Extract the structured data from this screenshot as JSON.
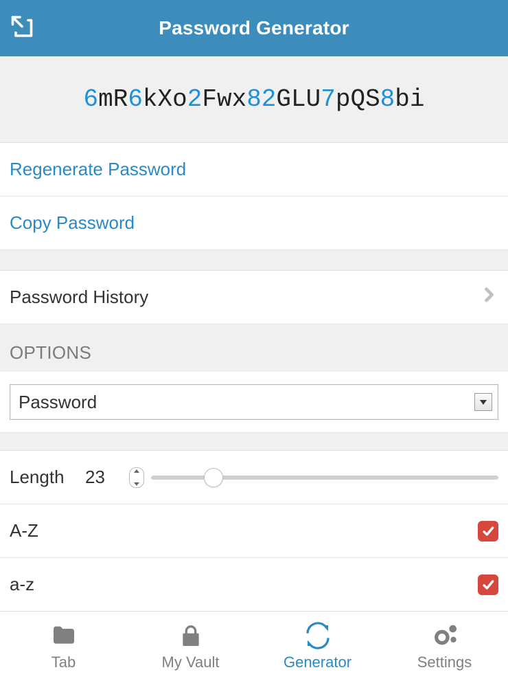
{
  "header": {
    "title": "Password Generator"
  },
  "generated_password_chars": [
    {
      "c": "6",
      "digit": true
    },
    {
      "c": "m",
      "digit": false
    },
    {
      "c": "R",
      "digit": false
    },
    {
      "c": "6",
      "digit": true
    },
    {
      "c": "k",
      "digit": false
    },
    {
      "c": "X",
      "digit": false
    },
    {
      "c": "o",
      "digit": false
    },
    {
      "c": "2",
      "digit": true
    },
    {
      "c": "F",
      "digit": false
    },
    {
      "c": "w",
      "digit": false
    },
    {
      "c": "x",
      "digit": false
    },
    {
      "c": "8",
      "digit": true
    },
    {
      "c": "2",
      "digit": true
    },
    {
      "c": "G",
      "digit": false
    },
    {
      "c": "L",
      "digit": false
    },
    {
      "c": "U",
      "digit": false
    },
    {
      "c": "7",
      "digit": true
    },
    {
      "c": "p",
      "digit": false
    },
    {
      "c": "Q",
      "digit": false
    },
    {
      "c": "S",
      "digit": false
    },
    {
      "c": "8",
      "digit": true
    },
    {
      "c": "b",
      "digit": false
    },
    {
      "c": "i",
      "digit": false
    }
  ],
  "actions": {
    "regenerate": "Regenerate Password",
    "copy": "Copy Password",
    "history": "Password History"
  },
  "options_header": "OPTIONS",
  "type_select": {
    "value": "Password"
  },
  "length": {
    "label": "Length",
    "value": "23",
    "min": 5,
    "max": 128,
    "slider_percent": 18
  },
  "charsets": {
    "upper": {
      "label": "A-Z",
      "checked": true
    },
    "lower": {
      "label": "a-z",
      "checked": true
    }
  },
  "tabs": {
    "tab": {
      "label": "Tab",
      "active": false
    },
    "vault": {
      "label": "My Vault",
      "active": false
    },
    "generator": {
      "label": "Generator",
      "active": true
    },
    "settings": {
      "label": "Settings",
      "active": false
    }
  },
  "colors": {
    "accent": "#2a8ac5",
    "header_bg": "#3c8dbc",
    "check_bg": "#d6483e"
  }
}
